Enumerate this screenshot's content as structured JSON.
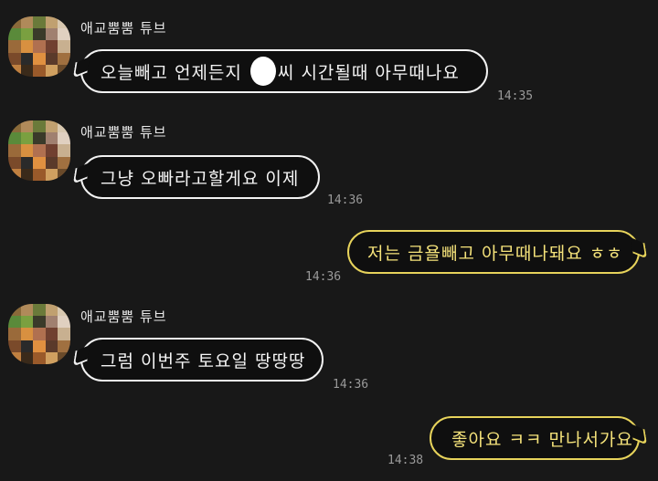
{
  "messages": [
    {
      "sender": "애교뿜뿜 튜브",
      "text_a": "오늘빼고 언제든지 ",
      "text_b": "씨 시간될때 아무때나요",
      "time": "14:35"
    },
    {
      "sender": "애교뿜뿜 튜브",
      "text": "그냥 오빠라고할게요 이제",
      "time": "14:36"
    },
    {
      "text": "저는 금욜빼고 아무때나돼요 ㅎㅎ",
      "time": "14:36"
    },
    {
      "sender": "애교뿜뿜 튜브",
      "text": "그럼 이번주 토요일 땅땅땅",
      "time": "14:36"
    },
    {
      "text": "좋아요 ㅋㅋ 만나서가요",
      "time": "14:38"
    }
  ],
  "colors": {
    "background": "#181818",
    "outgoing_border": "#e7d35b",
    "incoming_border": "#f2f2f2"
  },
  "icons": {
    "avatar": "blurred-profile-avatar",
    "redaction": "white-redaction-blob"
  }
}
